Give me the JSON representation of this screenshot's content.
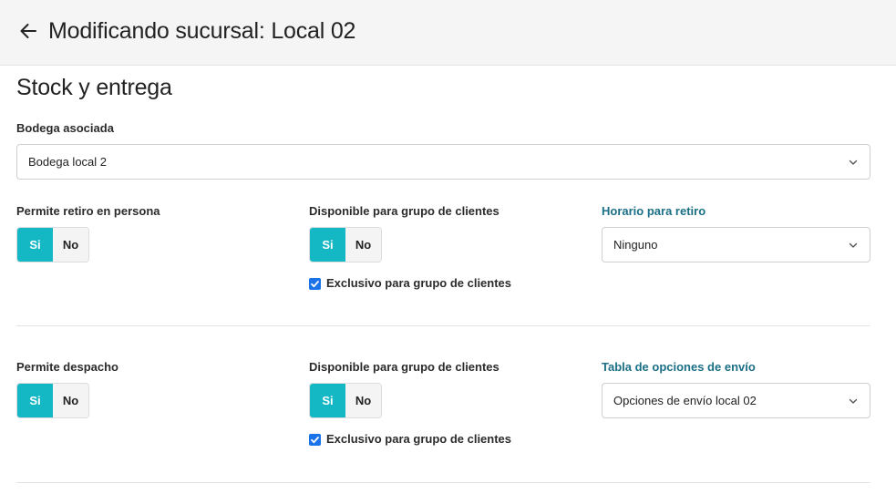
{
  "header": {
    "title": "Modificando sucursal: Local 02"
  },
  "section": {
    "title": "Stock y entrega"
  },
  "warehouse": {
    "label": "Bodega asociada",
    "value": "Bodega local 2"
  },
  "pickup": {
    "label": "Permite retiro en persona",
    "toggle": {
      "yes": "Si",
      "no": "No",
      "selected": "Si"
    },
    "group": {
      "label": "Disponible para grupo de clientes",
      "toggle": {
        "yes": "Si",
        "no": "No",
        "selected": "Si"
      },
      "exclusive_label": "Exclusivo para grupo de clientes",
      "exclusive_checked": true
    },
    "schedule": {
      "label": "Horario para retiro",
      "value": "Ninguno"
    }
  },
  "shipping": {
    "label": "Permite despacho",
    "toggle": {
      "yes": "Si",
      "no": "No",
      "selected": "Si"
    },
    "group": {
      "label": "Disponible para grupo de clientes",
      "toggle": {
        "yes": "Si",
        "no": "No",
        "selected": "Si"
      },
      "exclusive_label": "Exclusivo para grupo de clientes",
      "exclusive_checked": true
    },
    "options": {
      "label": "Tabla de opciones de envío",
      "value": "Opciones de envío local 02"
    }
  },
  "colors": {
    "toggle_on": "#14b8c4",
    "accent_label": "#1b6f86",
    "checkbox": "#1a73e8"
  },
  "icons": {
    "back": "arrow-left-icon",
    "dropdown": "chevron-down-icon",
    "check": "checkmark-icon"
  }
}
